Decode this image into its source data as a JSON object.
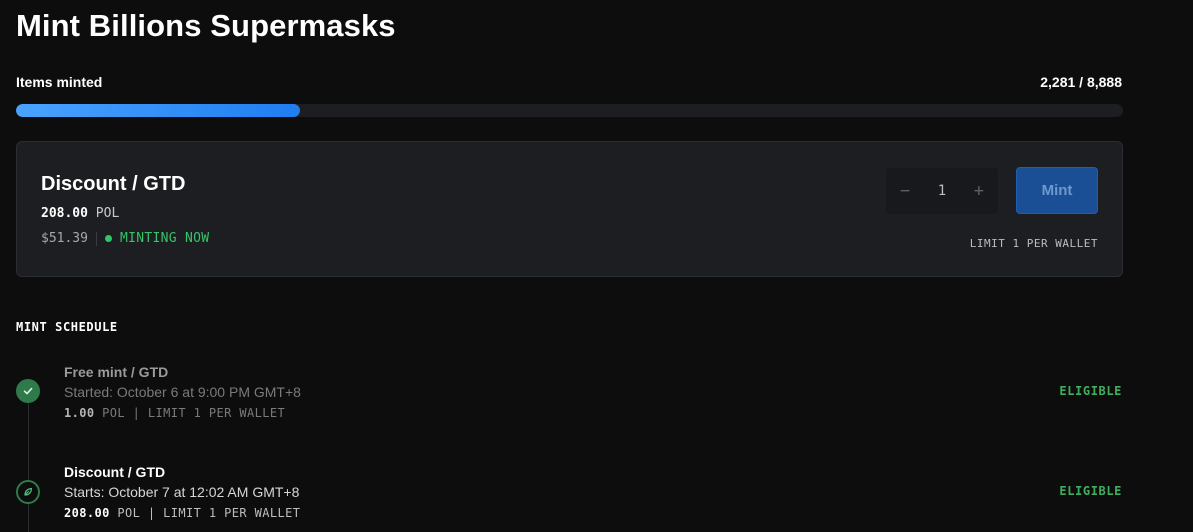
{
  "title": "Mint Billions Supermasks",
  "progress": {
    "label": "Items minted",
    "minted": "2,281",
    "separator": " / ",
    "total": "8,888",
    "fraction": 0.2566
  },
  "current_phase": {
    "name": "Discount / GTD",
    "price": "208.00",
    "currency": "POL",
    "usd": "$51.39",
    "status": "MINTING NOW",
    "quantity": "1",
    "minus_symbol": "−",
    "plus_symbol": "+",
    "mint_label": "Mint",
    "limit": "LIMIT 1 PER WALLET"
  },
  "schedule": {
    "header": "MINT SCHEDULE",
    "phases": [
      {
        "name": "Free mint / GTD",
        "time": "Started: October 6 at 9:00 PM GMT+8",
        "price": "1.00",
        "details": " POL | LIMIT 1 PER WALLET",
        "eligibility": "ELIGIBLE",
        "icon": "check-icon"
      },
      {
        "name": "Discount / GTD",
        "time": "Starts: October 7 at 12:02 AM GMT+8",
        "price": "208.00",
        "details": " POL | LIMIT 1 PER WALLET",
        "eligibility": "ELIGIBLE",
        "icon": "leaf-icon"
      }
    ]
  },
  "colors": {
    "accent": "#1f7df0",
    "status_green": "#35c46a",
    "eligible_green": "#3fae5f",
    "card_bg": "#1c1e21",
    "page_bg": "#0d0d0d"
  }
}
